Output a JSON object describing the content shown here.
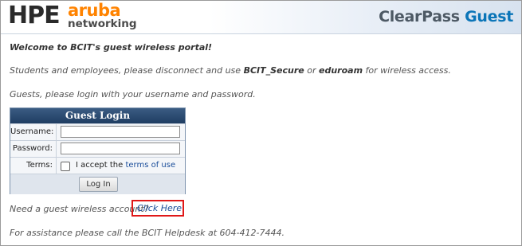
{
  "header": {
    "logo_hpe": "HPE",
    "logo_aruba": "aruba",
    "logo_networking": "networking",
    "brand_clearpass": "ClearPass",
    "brand_guest": "Guest"
  },
  "messages": {
    "welcome": "Welcome to BCIT's guest wireless portal!",
    "students_pre": "Students and employees, please disconnect and use ",
    "students_ssid1": "BCIT_Secure",
    "students_or": " or ",
    "students_ssid2": "eduroam",
    "students_post": " for wireless access.",
    "guests": "Guests, please login with your username and password.",
    "need_account": "Need a guest wireless account?",
    "assistance": "For assistance please call the BCIT Helpdesk at 604-412-7444."
  },
  "login": {
    "title": "Guest Login",
    "username_label": "Username:",
    "username_value": "",
    "password_label": "Password:",
    "password_value": "",
    "terms_label": "Terms:",
    "accept_text": "I accept the ",
    "terms_link": "terms of use",
    "terms_checked": false,
    "button": "Log In"
  },
  "click_here": "Click Here",
  "colors": {
    "accent_orange": "#ff8300",
    "brand_blue": "#0b75b8",
    "panel_header": "#1f3d62",
    "highlight_red": "#e01818"
  }
}
